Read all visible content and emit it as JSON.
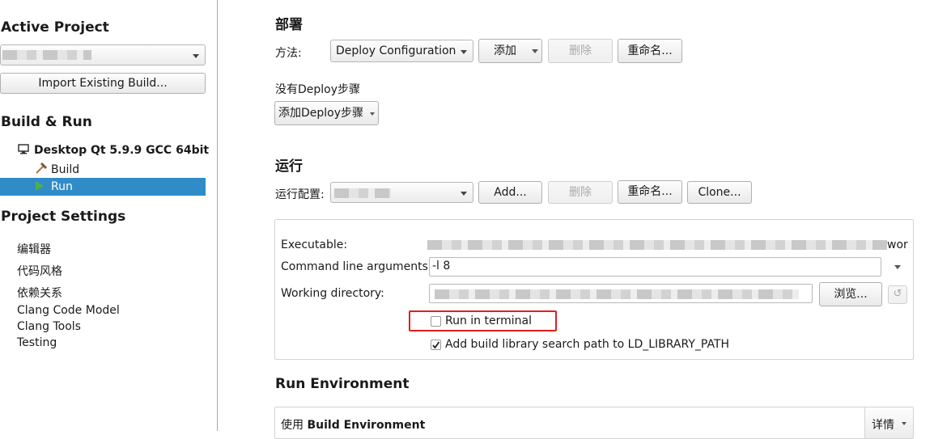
{
  "sidebar": {
    "active_project_heading": "Active Project",
    "import_button": "Import Existing Build...",
    "build_run_heading": "Build & Run",
    "kit_name": "Desktop Qt 5.9.9 GCC 64bit",
    "build_item": "Build",
    "run_item": "Run",
    "project_settings_heading": "Project Settings",
    "settings_items": [
      "编辑器",
      "代码风格",
      "依赖关系",
      "Clang Code Model",
      "Clang Tools",
      "Testing"
    ]
  },
  "deploy": {
    "heading": "部署",
    "method_label": "方法:",
    "method_value": "Deploy Configuration",
    "add_button": "添加",
    "delete_button": "删除",
    "rename_button": "重命名...",
    "no_steps_text": "没有Deploy步骤",
    "add_step_button": "添加Deploy步骤"
  },
  "run": {
    "heading": "运行",
    "config_label": "运行配置:",
    "add_button": "Add...",
    "delete_button": "删除",
    "rename_button": "重命名...",
    "clone_button": "Clone...",
    "executable_label": "Executable:",
    "executable_suffix": "worl",
    "args_label": "Command line arguments:",
    "args_value": "-l 8",
    "workdir_label": "Working directory:",
    "browse_button": "浏览...",
    "run_in_terminal_label": "Run in terminal",
    "run_in_terminal_checked": false,
    "ld_path_label": "Add build library search path to LD_LIBRARY_PATH",
    "ld_path_checked": true
  },
  "run_env": {
    "heading": "Run Environment",
    "use_prefix": "使用",
    "env_name": "Build Environment",
    "details_button": "详情"
  },
  "colors": {
    "selection": "#308cc6",
    "highlight_box": "#e02020",
    "run_icon": "#4caf50",
    "build_icon": "#c0733a"
  }
}
